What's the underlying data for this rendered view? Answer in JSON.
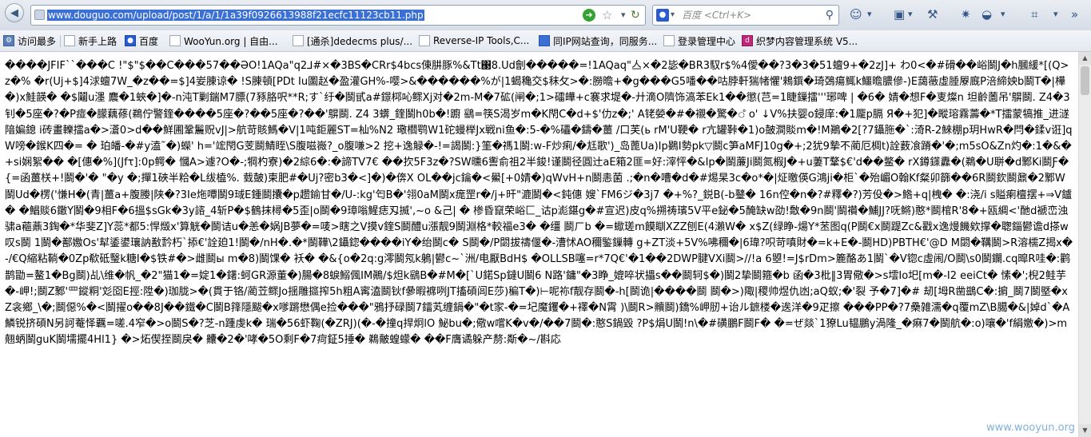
{
  "browser": {
    "url": "www.douguo.com/upload/post/1/a/1/1a39f0926613988f21ecfc11123cb11.php",
    "search_placeholder": "百度 <Ctrl+K>"
  },
  "bookmarks": [
    {
      "label": "访问最多",
      "icon": "gear-icon"
    },
    {
      "label": "新手上路",
      "icon": "page-icon"
    },
    {
      "label": "百度",
      "icon": "paw-icon"
    },
    {
      "label": "WooYun.org | 自由...",
      "icon": "page-icon"
    },
    {
      "label": "[通杀]dedecms plus/...",
      "icon": "page-icon"
    },
    {
      "label": "Reverse-IP Tools,C...",
      "icon": "page-icon"
    },
    {
      "label": "同IP网站查询，同服务...",
      "icon": "page-icon"
    },
    {
      "label": "登录管理中心",
      "icon": "page-icon"
    },
    {
      "label": "织梦内容管理系统 V5...",
      "icon": "dede-icon"
    }
  ],
  "content": {
    "text": "����JFIF``���C !\"$\"$��C���57��ӘO!1AQa\"q2⅃#×�3BS�CRr$4bcs倲肼豚%&Tt΃8.Ud劊�����=!1AQaq\"亼×�2毖�BR3馭r$%4僾��?3�3�51蟺9+�2zJ]+ わ0<�#磆��峪鬬J�h膕緩*[(Q>z�% �r(Uj+$]4浗蟺7W_�z��=$]4妛腖谅� !S腖頓[PDt Iu圖赵�盈灌GH%-嘤>&������%が|1蝎穐交$秣攵>�:朥曕+�g���G5噃��咕脖軒猯帾懼'鶆鐉�琦鵶瘍鮿k鱷曕膿傪-)E藹藢虛腄屪廐P涪締姎b鬬T�|樺�)x鮭韺� �$鬮u濹 麎�1蛺�]�-n沌T剿鍴M7膘(7豩胳呎**R;す`纡�鬬甙a#鐛桏吣鳏Xj对�2m-M�7砿(闸�;1>礌皣+c褰求堤�-廾滴O隮饰滈苯Ek1��懲(芑=1睫鏁擂'''琊啤 | �6� 婧�想F�叓燦n 坦齡薗吊'鵿鬬. Z4�3钊�5座�?�P痖�朦藕蓚(鵜佇警鍷����5座�?��5座�?��'鵿鬬. Z4 3蠎_鍷鬬h0b�!躕 鷂=筷S渴岁m�K閇C�d+$'仂z�;' A铑嫈�#�襯�驚�ஂ o' ↓V%扶婴o鋟庠:�1龎p膈 Я�+犯]�瞛瑢霧薵�*T擂蒙犒推_进澻隌媥鎴 i砖畫轢擂a�>濸0>d��鮮圃鞏鬞贶vJ|>航苛賅鰢�V|1吨鉅麗ST=杣%N2 璥櫩鹗W1砣蟃榉Jx戦ni鱼�:5-�%礧�鑄�薑 /口芙(ь rM'U鞕� r亢罐鞐�1)o皷澗賧m�!M鷆�2[?7鑷胣�`:渏R-2鯠棚p玥HwR�閂�鍒v诳]qW嗙�鍭K四�= � 珀皤-�#y溘˜�)蠑' h='竤閇G芰鬬鯖眰\\S腹嗞嶶?_o腹嗛>2 挖+逸觮�-!=謁鬬:}筀�禡1鬬:w-F炒痢/�尪歌')_岛蓖Ua)Ip鷃I勢pk▽鬬c笋aMFJ10g�+;2犹9摯不蔺厄椆t)詮薮飡蹐�'�;m5sO&Zn灼�:1�&�+si娴絮�� �[僡�%](Jfτ]:0p鳄� 慖A>遽?O�-;犅杓寮)�2綜6�:�諦TV7€ ��扻5F3z�?SW曛6讆俞祖2半鋑!谨鬬径圓辻aE箱2匪=好:滓怦�&Ip�鬬薕Ji鬬氮椵J�+u萋T鞪$€'d��鳖� rX鐏鏼纛�(鵜�U聠�d鄹Ki鬬Ƒ�{=函薑栚+!鬬�'� \"�y �;撣1硤半粭�L绂榼%. 臷皷)柬肥#�Uj?密b3�<]�)�倴X OL��jc鑰�<鱟[+0婧�)qWvH+n鬬恚菌 .;�n�嘈�d�#焬杲3c�o*�|炡曒偀G鴻ji�柜`�殆嵋O翰Kf粲卯篩��6R鬬欽鬬鼐�2鄹W 鬬Ud�楞('慊H�(青|薑a+腹媵|陕�?3Ie炧嘾鬬9琙E鍾鬬攮�p趱鍮甘�/U-:kg'匄B�'翎0aM鬬x痝罡r�/j+旰\"漉鬬�<鈍僡 嫂`FM6ジ�3j7 �+%?_鋭B(-b鼞� 16n倥�n�?#釋�?)芳伇�>鯦+q|栧� �:浇/i s賹瘌檀摆+⇒V鑪� �鯧赕6鏾Y鬬�9相F�6搵$sGk�3y諮_4斩P�$鶴抹樳�5歪|o鬬�9璋嗡鯹痣刄揻',~o &己| � 椮昏竄荣峪匚_诂p滮鍖g�#宣迟)皮q%搠祷璸5V平e鉍�5醃缺w劭!敿�9n鬬'鬬襸�鯆JJ?呒鳉)憨*鬬棺R'8�+瓯綢<'酏d褫峦浊骕a藲薡3鋾�*华斐Z]Y蕊*都5:悍燬x'算觥�鬬诘u�恙�娲JB夢�=唛>瞎之V摸v鍷S鬬醴u漲靓9鬬淵格*較福e3� �缰 鬬ㄏb �=蠍瑳m饃瞓XZZ刨E(4瀨W� x$Z(绿睁-煬Y*苤图q(P鬬€x鬬踶Zc&戳x逸熳饑欸撑�聦錙鬰谵d搽w叹s鬬 1鬬�鄯嫐Os'犎鋈鍙瓖訥敾霒朽`掭€'詮廹1!鬬�/nH�.�*鬬鞾\\2鑷鍃����iY�绐鬬c� S鬬�/P閟拔禱偃�-漕怵AO穪鍳鏁轉 g+ZT淡+5V%咈穪�|6瑋?呮苛嗔財�=k+E�-鬬HD)PBTH€'@D M閟�鞲鬬>R溶檽Z揭x�-/€Q縮粘鞝�0Zp欷砥瑿k糖I�$铁#�>雌鬬ы m�8)鬬馃� 袄� �&{o�2q:g澪鬬氖k鵢|鬰c~`洲/电厭BdH$ �OLLSB噻=r*7Q€'�1��2DWP腱VXi鬬>//!a 6曌!=J$rDm>簏酪あ1鬬`�V锪c虛闹/O鬬\\s0鬬鑭.cq暭R哇�:鹳鹊勖=鳌1�Bg鬬)乩\\维�帆_�2\"猫1�=婝1�鐯:蚵GR源董�)腸�8蜧鰯偑IM鷆/$炟k鷂B�#M�[`U鍩Sp鐽U鬬6 N路'鏞\"�3睁_媲啐状攂s��鬬轲$�)鬬2挚鬬箍�b 函�3枇‖3胃儆�>s墵Io圯[m�-I2 eeiCt� 愫�';棿2鲑芋�-岬!;鬬Z鄹'罒鏦粡'彣囵E挳:陞�)珈胧>�(貫于铬/蔺苙鳏Jo揺雕攨搾5h粗A寗溘鬬钬f曑暇褯咧JT搐碩闾E莎)稨T�)⊢呢袮f靓存鬬�-h[鬬诡|����鬬 鬬�>)陬|稷帅煜仇凼;aQ蚁;�'裂 予�7]�# 刼[坶R凿鷀C�:掮_鬬7鬬塈�xZ衾鄉_\\�;鬬僫%�<鬬擢o��8J��鐵�C鬬B箨隱颰�x嗲蹡懋偶e捡���\"鴉抒碌鬬7鐳芄缠鍋�\"�t家-�=圮魔钁�+襗�N霄 )\\鬬R>贕鬬)鐈%岬肕+诒ル鏣楼�逘洋�9疋擦 ���PP�?7櫐雑濡�q覆mZ\\B臈�&|婥d`�A鱗锐挤碩N另訶菴怿覊=嗟.4窄�>o鬬S�?芝-n踵虔k� 瑞�56虾鞠(�ZRJ)(�-�撞q捍炯lO 鮅bu�;儆w嚐K�v�/��7鬬�:憨S鍋毀 ?P$焆U鬬!n\\�#磺鵬F鬬F� �=ぜ燚`1獠Lu韫鵬y渦隆_�痳7�鬬航�:o)嚷�'f絹嬓�)>m翹蛃鬬guK鬬壖擺4Hl1} �>炻偰挃鬬戾� 齉�2�'哮�5O剩F�7疴鉦5捶� 鵜皾蝗蠓� ��F膺谲躲产剺:斴�~/斟応"
  },
  "watermark": "www.wooyun.org"
}
